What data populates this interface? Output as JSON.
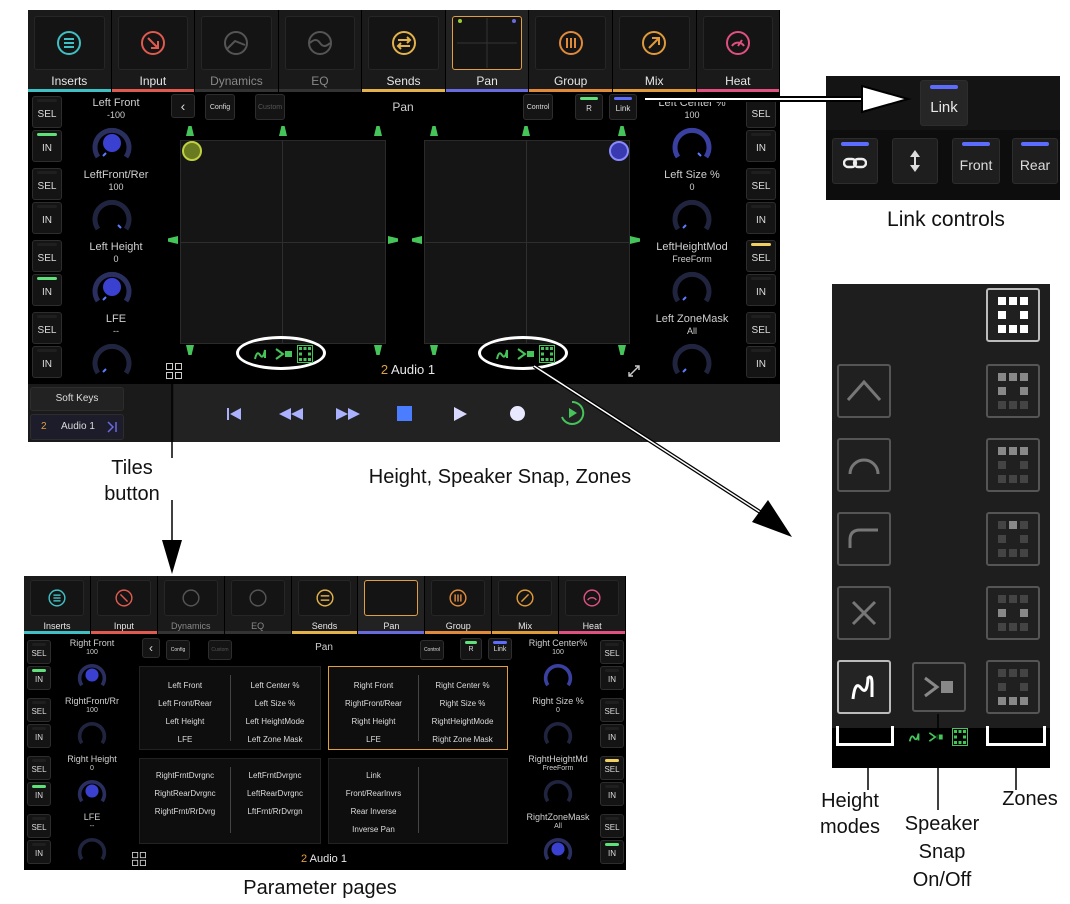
{
  "colors": {
    "inserts": "#3fc0c4",
    "input": "#e05a4f",
    "dynamics": "#888888",
    "eq": "#888888",
    "sends": "#e3b24a",
    "pan": "#6a6adf",
    "group": "#e08a3a",
    "mix": "#e09a3a",
    "heat": "#e05080",
    "led_green": "#5fe07a",
    "led_blue": "#5b6cff",
    "led_yellow": "#f0d060",
    "speaker_green": "#45c45a",
    "knob_blue": "#3a40d0",
    "tiles_orange": "#e0a040"
  },
  "tabs": [
    {
      "label": "Inserts",
      "icon": "list-icon"
    },
    {
      "label": "Input",
      "icon": "input-arrow-icon"
    },
    {
      "label": "Dynamics",
      "icon": "dynamics-icon"
    },
    {
      "label": "EQ",
      "icon": "eq-curve-icon"
    },
    {
      "label": "Sends",
      "icon": "sends-arrows-icon"
    },
    {
      "label": "Pan",
      "icon": "pan-grid-icon"
    },
    {
      "label": "Group",
      "icon": "group-bars-icon"
    },
    {
      "label": "Mix",
      "icon": "mix-arrow-icon"
    },
    {
      "label": "Heat",
      "icon": "heat-gauge-icon"
    }
  ],
  "main": {
    "toolbar": {
      "config": "Config",
      "custom": "Custom",
      "title": "Pan",
      "control": "Control",
      "r": "R",
      "link": "Link"
    },
    "left_params": [
      {
        "name": "Left Front",
        "value": "-100"
      },
      {
        "name": "LeftFront/Rer",
        "value": "100"
      },
      {
        "name": "Left Height",
        "value": "0"
      },
      {
        "name": "LFE",
        "value": "--"
      }
    ],
    "right_params": [
      {
        "name": "Left Center %",
        "value": "100"
      },
      {
        "name": "Left Size %",
        "value": "0"
      },
      {
        "name": "LeftHeightMod",
        "value": "FreeForm"
      },
      {
        "name": "Left ZoneMask",
        "value": "All"
      }
    ],
    "sel": "SEL",
    "in": "IN",
    "track_number": "2",
    "track_name": "Audio 1",
    "soft_keys": "Soft Keys",
    "track_list_number": "2",
    "track_list_name": "Audio 1"
  },
  "link_panel": {
    "link": "Link",
    "front": "Front",
    "rear": "Rear"
  },
  "small": {
    "toolbar": {
      "config": "Config",
      "custom": "Custom",
      "title": "Pan",
      "control": "Control",
      "r": "R",
      "link": "Link"
    },
    "left_params": [
      {
        "name": "Right Front",
        "value": "100"
      },
      {
        "name": "RightFront/Rr",
        "value": "100"
      },
      {
        "name": "Right Height",
        "value": "0"
      },
      {
        "name": "LFE",
        "value": "--"
      }
    ],
    "right_params": [
      {
        "name": "Right Center%",
        "value": "100"
      },
      {
        "name": "Right Size %",
        "value": "0"
      },
      {
        "name": "RightHeightMd",
        "value": "FreeForm"
      },
      {
        "name": "RightZoneMask",
        "value": "All"
      }
    ],
    "pages": [
      {
        "col1": [
          "Left Front",
          "Left Front/Rear",
          "Left Height",
          "LFE"
        ],
        "col2": [
          "Left Center %",
          "Left Size %",
          "Left HeightMode",
          "Left Zone Mask"
        ]
      },
      {
        "col1": [
          "Right Front",
          "RightFront/Rear",
          "Right Height",
          "LFE"
        ],
        "col2": [
          "Right Center %",
          "Right Size %",
          "RightHeightMode",
          "Right Zone Mask"
        ]
      },
      {
        "col1": [
          "RightFrntDvrgnc",
          "RightRearDvrgnc",
          "RightFrnt/RrDvrg"
        ],
        "col2": [
          "LeftFrntDvrgnc",
          "LeftRearDvrgnc",
          "LftFrnt/RrDvrgn"
        ]
      },
      {
        "col1": [
          "Link",
          "Front/RearInvrs",
          "Rear Inverse",
          "Inverse Pan"
        ],
        "col2": []
      }
    ],
    "track_number": "2",
    "track_name": "Audio 1"
  },
  "captions": {
    "link_controls": "Link controls",
    "tiles_button": "Tiles button",
    "height_snap_zones": "Height, Speaker Snap, Zones",
    "parameter_pages": "Parameter pages",
    "height_modes": "Height modes",
    "speaker_snap": "Speaker Snap On/Off",
    "zones": "Zones"
  }
}
